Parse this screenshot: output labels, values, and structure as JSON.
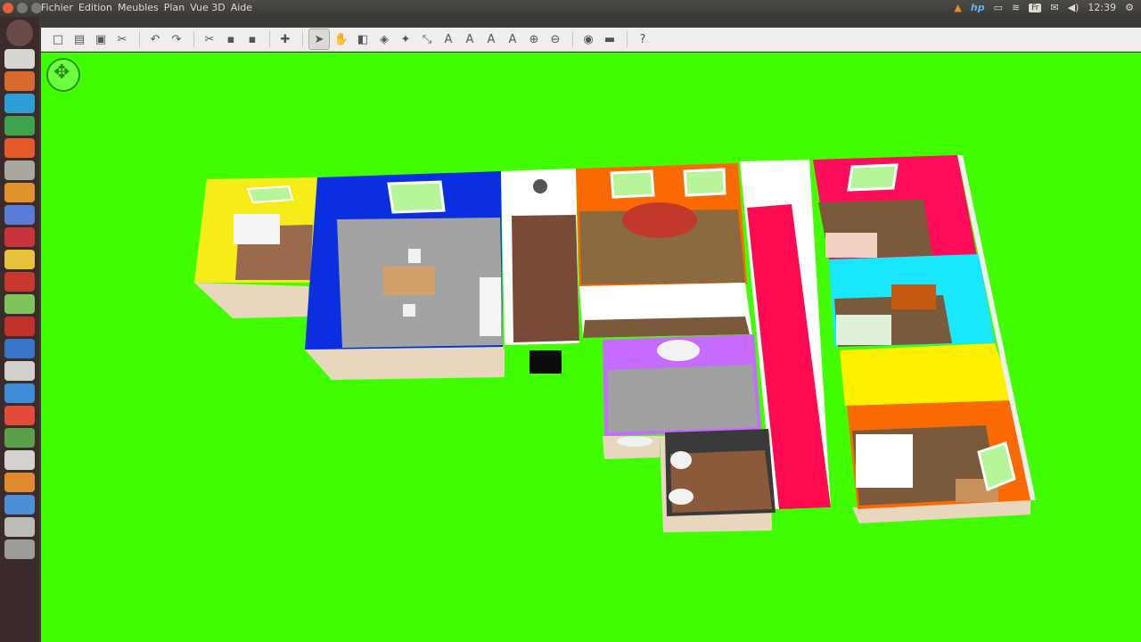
{
  "menu": {
    "items": [
      "Fichier",
      "Edition",
      "Meubles",
      "Plan",
      "Vue 3D",
      "Aide"
    ]
  },
  "tray": {
    "kb_layout": "Fr",
    "clock": "12:39",
    "brand": "hp"
  },
  "toolbar": {
    "buttons": [
      {
        "name": "new-home-icon",
        "glyph": "□"
      },
      {
        "name": "open-icon",
        "glyph": "▤"
      },
      {
        "name": "save-icon",
        "glyph": "▣"
      },
      {
        "name": "preferences-icon",
        "glyph": "✂"
      },
      {
        "name": "undo-icon",
        "glyph": "↶"
      },
      {
        "name": "redo-icon",
        "glyph": "↷"
      },
      {
        "name": "cut-icon",
        "glyph": "✂"
      },
      {
        "name": "copy-icon",
        "glyph": "▪"
      },
      {
        "name": "paste-icon",
        "glyph": "▪"
      },
      {
        "name": "add-furniture-icon",
        "glyph": "✚"
      },
      {
        "name": "select-icon",
        "glyph": "➤"
      },
      {
        "name": "pan-icon",
        "glyph": "✋"
      },
      {
        "name": "create-walls-icon",
        "glyph": "◧"
      },
      {
        "name": "create-rooms-icon",
        "glyph": "◈"
      },
      {
        "name": "create-polylines-icon",
        "glyph": "✦"
      },
      {
        "name": "create-dimensions-icon",
        "glyph": "⤡"
      },
      {
        "name": "add-text-icon",
        "glyph": "A"
      },
      {
        "name": "increase-text-icon",
        "glyph": "A"
      },
      {
        "name": "decrease-text-icon",
        "glyph": "A"
      },
      {
        "name": "bold-text-icon",
        "glyph": "A"
      },
      {
        "name": "zoom-in-icon",
        "glyph": "⊕"
      },
      {
        "name": "zoom-out-icon",
        "glyph": "⊖"
      },
      {
        "name": "create-photo-icon",
        "glyph": "◉"
      },
      {
        "name": "create-video-icon",
        "glyph": "▬"
      },
      {
        "name": "help-icon",
        "glyph": "?"
      }
    ]
  },
  "colors": {
    "view_background": "#42ff00",
    "wall_top": "#ffffff",
    "wall_exterior": "#e9d6bf"
  }
}
